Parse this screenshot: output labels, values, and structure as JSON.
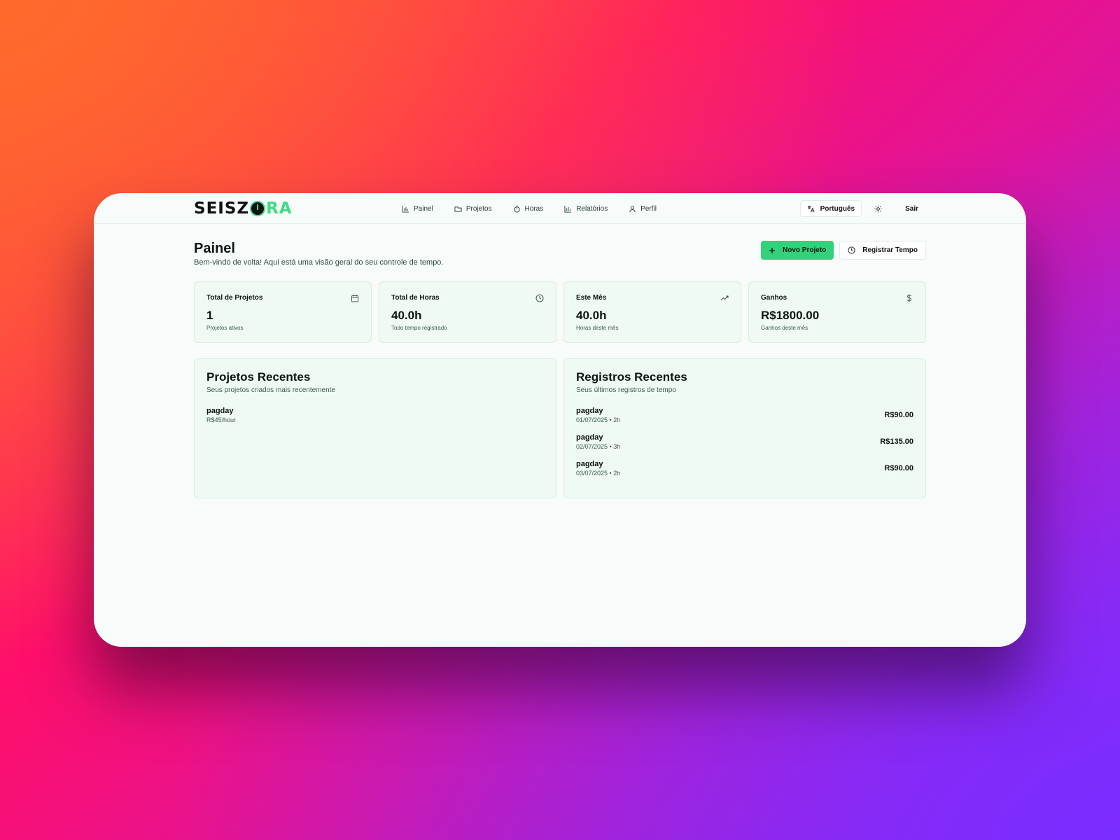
{
  "brand": {
    "part1": "SEISZ",
    "part2": "RA"
  },
  "nav": {
    "items": [
      {
        "label": "Painel",
        "icon": "bar-chart-icon"
      },
      {
        "label": "Projetos",
        "icon": "folder-icon"
      },
      {
        "label": "Horas",
        "icon": "stopwatch-icon"
      },
      {
        "label": "Relatórios",
        "icon": "bar-chart-icon"
      },
      {
        "label": "Perfil",
        "icon": "user-icon"
      }
    ]
  },
  "tools": {
    "language": "Português",
    "logout": "Sair"
  },
  "header": {
    "title": "Painel",
    "subtitle": "Bem-vindo de volta! Aqui está uma visão geral do seu controle de tempo.",
    "new_project": "Novo Projeto",
    "log_time": "Registrar Tempo"
  },
  "stats": [
    {
      "label": "Total de Projetos",
      "value": "1",
      "caption": "Projetos ativos",
      "icon": "calendar-icon"
    },
    {
      "label": "Total de Horas",
      "value": "40.0h",
      "caption": "Todo tempo registrado",
      "icon": "clock-icon"
    },
    {
      "label": "Este Mês",
      "value": "40.0h",
      "caption": "Horas deste mês",
      "icon": "trending-up-icon"
    },
    {
      "label": "Ganhos",
      "value": "R$1800.00",
      "caption": "Ganhos deste mês",
      "icon": "dollar-icon"
    }
  ],
  "recent_projects": {
    "title": "Projetos Recentes",
    "subtitle": "Seus projetos criados mais recentemente",
    "items": [
      {
        "name": "pagday",
        "rate": "R$45/hour"
      }
    ]
  },
  "recent_entries": {
    "title": "Registros Recentes",
    "subtitle": "Seus últimos registros de tempo",
    "items": [
      {
        "name": "pagday",
        "meta": "01/07/2025 • 2h",
        "amount": "R$90.00"
      },
      {
        "name": "pagday",
        "meta": "02/07/2025 • 3h",
        "amount": "R$135.00"
      },
      {
        "name": "pagday",
        "meta": "03/07/2025 • 2h",
        "amount": "R$90.00"
      }
    ]
  },
  "colors": {
    "accent": "#33d17a",
    "card_bg": "#effaf3",
    "page_bg": "#f7fcfa"
  }
}
